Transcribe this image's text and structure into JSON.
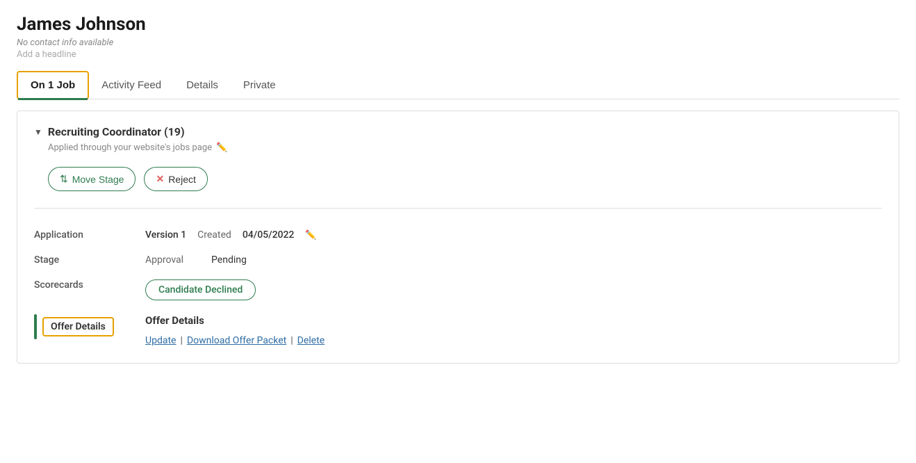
{
  "candidate": {
    "name": "James Johnson",
    "no_contact": "No contact info available",
    "add_headline": "Add a headline"
  },
  "tabs": [
    {
      "label": "On 1 Job",
      "active": true
    },
    {
      "label": "Activity Feed",
      "active": false
    },
    {
      "label": "Details",
      "active": false
    },
    {
      "label": "Private",
      "active": false
    }
  ],
  "job": {
    "title": "Recruiting Coordinator (19)",
    "applied_through": "Applied through your website's jobs page"
  },
  "buttons": {
    "move_stage": "Move Stage",
    "reject": "Reject"
  },
  "application": {
    "label": "Application",
    "version_label": "Version 1",
    "created_label": "Created",
    "date": "04/05/2022",
    "approval_label": "Approval",
    "pending_label": "Pending"
  },
  "stage": {
    "label": "Stage"
  },
  "scorecards": {
    "label": "Scorecards",
    "badge": "Candidate Declined"
  },
  "offer_details": {
    "label": "Offer Details",
    "title": "Offer Details",
    "update": "Update",
    "download": "Download Offer Packet",
    "delete": "Delete"
  }
}
